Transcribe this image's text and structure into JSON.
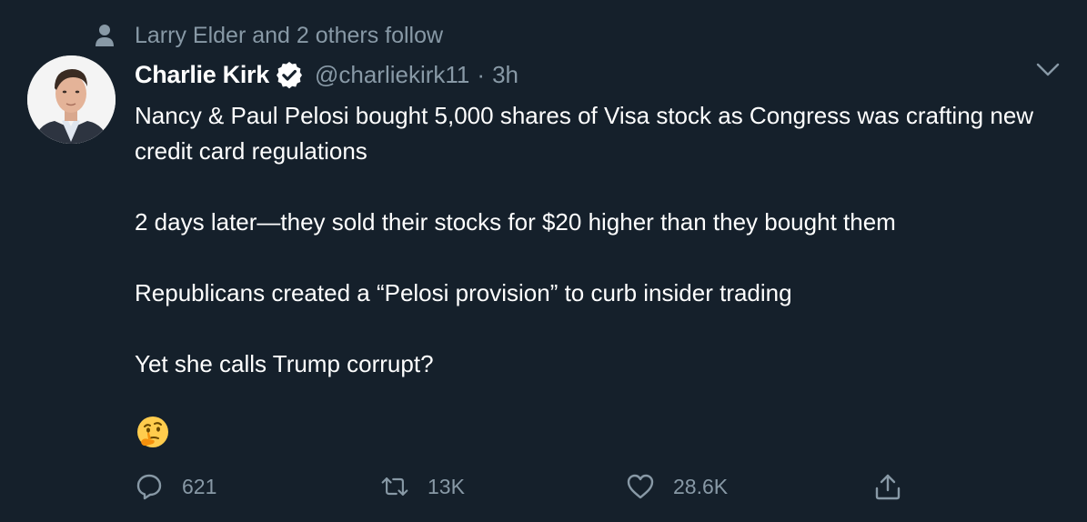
{
  "social_context": {
    "text": "Larry Elder and 2 others follow",
    "icon": "person-icon"
  },
  "author": {
    "display_name": "Charlie Kirk",
    "verified": true,
    "handle": "@charliekirk11",
    "separator": "·",
    "time": "3h"
  },
  "tweet": {
    "paragraphs": [
      "Nancy & Paul Pelosi bought 5,000 shares of Visa stock as Congress was crafting new credit card regulations",
      "2 days later—they sold their stocks for $20 higher than they bought them",
      "Republicans created a “Pelosi provision” to curb insider trading",
      "Yet she calls Trump corrupt?"
    ],
    "emoji": "thinking-face"
  },
  "actions": {
    "reply_count": "621",
    "retweet_count": "13K",
    "like_count": "28.6K"
  },
  "colors": {
    "background": "#15202b",
    "secondary_text": "#8899a6",
    "primary_text": "#ffffff",
    "verified_badge": "#ffffff"
  }
}
